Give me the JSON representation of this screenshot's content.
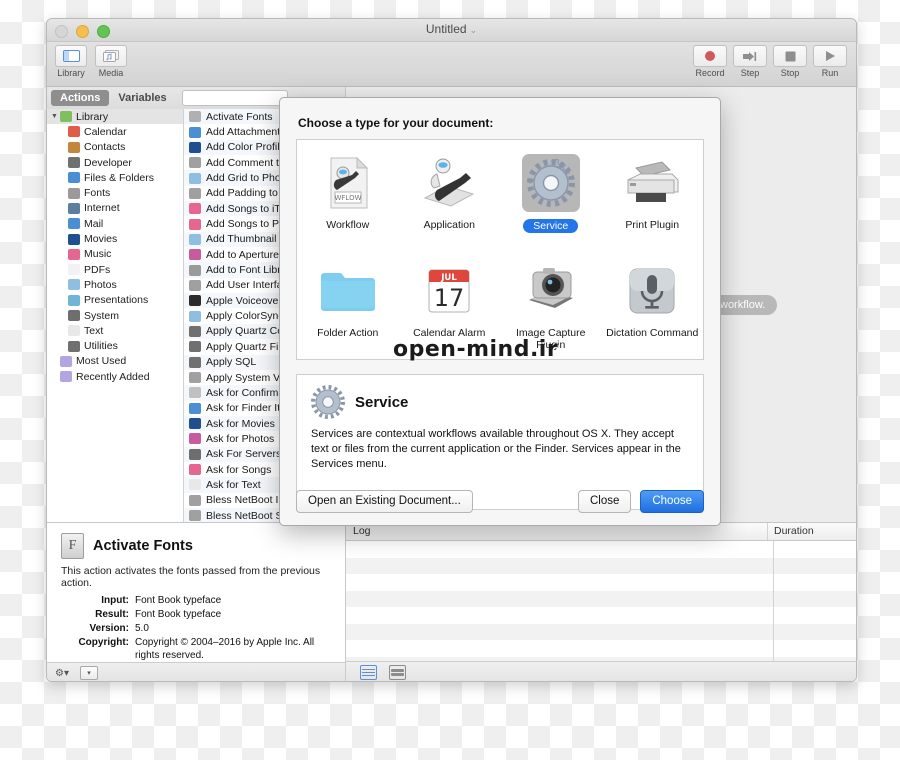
{
  "window": {
    "title": "Untitled",
    "title_chevron": "⌄"
  },
  "toolbar": {
    "left_buttons": [
      {
        "label": "Library",
        "icon": "sidebar-icon",
        "active": true
      },
      {
        "label": "Media",
        "icon": "media-icon",
        "active": false
      }
    ],
    "right_buttons": [
      {
        "label": "Record",
        "icon": "record-icon"
      },
      {
        "label": "Step",
        "icon": "step-icon"
      },
      {
        "label": "Stop",
        "icon": "stop-icon"
      },
      {
        "label": "Run",
        "icon": "run-icon"
      }
    ]
  },
  "tabs": {
    "items": [
      {
        "label": "Actions",
        "active": true
      },
      {
        "label": "Variables",
        "active": false
      }
    ],
    "search_value": "",
    "search_placeholder": ""
  },
  "sidebar": {
    "items": [
      {
        "label": "Library",
        "level": 0,
        "color": "#7fbf5f",
        "header": true
      },
      {
        "label": "Calendar",
        "level": 1,
        "color": "#e05c4a"
      },
      {
        "label": "Contacts",
        "level": 1,
        "color": "#c2873c"
      },
      {
        "label": "Developer",
        "level": 1,
        "color": "#707070"
      },
      {
        "label": "Files & Folders",
        "level": 1,
        "color": "#4a8fd4"
      },
      {
        "label": "Fonts",
        "level": 1,
        "color": "#9a9a9a"
      },
      {
        "label": "Internet",
        "level": 1,
        "color": "#5b7f9e"
      },
      {
        "label": "Mail",
        "level": 1,
        "color": "#4a8fd4"
      },
      {
        "label": "Movies",
        "level": 1,
        "color": "#1f4f8f"
      },
      {
        "label": "Music",
        "level": 1,
        "color": "#e7668f"
      },
      {
        "label": "PDFs",
        "level": 1,
        "color": "#f2f2f2"
      },
      {
        "label": "Photos",
        "level": 1,
        "color": "#8fbfe0"
      },
      {
        "label": "Presentations",
        "level": 1,
        "color": "#6fb5d8"
      },
      {
        "label": "System",
        "level": 1,
        "color": "#6e6e6e"
      },
      {
        "label": "Text",
        "level": 1,
        "color": "#e8e8e8"
      },
      {
        "label": "Utilities",
        "level": 1,
        "color": "#707070"
      },
      {
        "label": "Most Used",
        "level": 2,
        "color": "#b3a6e0"
      },
      {
        "label": "Recently Added",
        "level": 2,
        "color": "#b3a6e0"
      }
    ]
  },
  "actions": {
    "items": [
      {
        "label": "Activate Fonts",
        "color": "#b0b0b0",
        "selected": true
      },
      {
        "label": "Add Attachments to Front Message",
        "color": "#4a8fd4"
      },
      {
        "label": "Add Color Profile",
        "color": "#1f4f8f"
      },
      {
        "label": "Add Comment to DVD Track",
        "color": "#a0a0a0"
      },
      {
        "label": "Add Grid to Photos",
        "color": "#8fbfe0"
      },
      {
        "label": "Add Padding to Photos",
        "color": "#a0a0a0"
      },
      {
        "label": "Add Songs to iTunes",
        "color": "#e7668f"
      },
      {
        "label": "Add Songs to Playlist",
        "color": "#e7668f"
      },
      {
        "label": "Add Thumbnail Icon to Image Files",
        "color": "#8fbfe0"
      },
      {
        "label": "Add to Aperture Library",
        "color": "#c85a9e"
      },
      {
        "label": "Add to Font Library",
        "color": "#9a9a9a"
      },
      {
        "label": "Add User Interface Elements",
        "color": "#a0a0a0"
      },
      {
        "label": "Apple Voiceover Utility",
        "color": "#2b2b2b"
      },
      {
        "label": "Apply ColorSync Profile to Images",
        "color": "#8fbfe0"
      },
      {
        "label": "Apply Quartz Composition Filter",
        "color": "#707070"
      },
      {
        "label": "Apply Quartz Filter to PDF Documents",
        "color": "#707070"
      },
      {
        "label": "Apply SQL",
        "color": "#707070"
      },
      {
        "label": "Apply System Voice",
        "color": "#a0a0a0"
      },
      {
        "label": "Ask for Confirmation",
        "color": "#c0c0c0"
      },
      {
        "label": "Ask for Finder Items",
        "color": "#4a8fd4"
      },
      {
        "label": "Ask for Movies",
        "color": "#1f4f8f"
      },
      {
        "label": "Ask for Photos",
        "color": "#c85a9e"
      },
      {
        "label": "Ask For Servers",
        "color": "#6e6e6e"
      },
      {
        "label": "Ask for Songs",
        "color": "#e7668f"
      },
      {
        "label": "Ask for Text",
        "color": "#e8e8e8"
      },
      {
        "label": "Bless NetBoot Image",
        "color": "#a0a0a0"
      },
      {
        "label": "Bless NetBoot Server",
        "color": "#a0a0a0"
      }
    ]
  },
  "main": {
    "hint_pill": "workflow."
  },
  "info_panel": {
    "icon": "font-file-icon",
    "title": "Activate Fonts",
    "description": "This action activates the fonts passed from the previous action.",
    "rows": [
      {
        "key": "Input:",
        "value": "Font Book typeface"
      },
      {
        "key": "Result:",
        "value": "Font Book typeface"
      },
      {
        "key": "Version:",
        "value": "5.0"
      },
      {
        "key": "Copyright:",
        "value": "Copyright © 2004–2016 by Apple Inc. All rights reserved."
      }
    ],
    "bottom_icons": [
      "gear-icon",
      "chevron-down-icon"
    ]
  },
  "log_panel": {
    "columns": [
      "Log",
      "Duration"
    ],
    "rows": [],
    "row_count": 8,
    "bottom_icons": [
      "list-view-icon",
      "stack-view-icon"
    ]
  },
  "dialog": {
    "title": "Choose a type for your document:",
    "types": [
      {
        "label": "Workflow",
        "icon": "workflow-icon",
        "selected": false
      },
      {
        "label": "Application",
        "icon": "application-icon",
        "selected": false
      },
      {
        "label": "Service",
        "icon": "service-gear-icon",
        "selected": true
      },
      {
        "label": "Print Plugin",
        "icon": "printer-icon",
        "selected": false
      },
      {
        "label": "Folder Action",
        "icon": "folder-icon",
        "selected": false
      },
      {
        "label": "Calendar Alarm",
        "icon": "calendar-icon",
        "selected": false
      },
      {
        "label": "Image Capture Plugin",
        "icon": "camera-icon",
        "selected": false
      },
      {
        "label": "Dictation Command",
        "icon": "microphone-icon",
        "selected": false
      }
    ],
    "calendar_icon": {
      "month": "JUL",
      "day": "17"
    },
    "workflow_icon_badge": "WFLOW",
    "detail": {
      "icon": "service-gear-icon",
      "title": "Service",
      "body": "Services are contextual workflows available throughout OS X. They accept text or files from the current application or the Finder. Services appear in the Services menu."
    },
    "buttons": {
      "open_existing": "Open an Existing Document...",
      "close": "Close",
      "choose": "Choose"
    }
  },
  "watermark": {
    "text": "open-mind.ir"
  },
  "colors": {
    "accent_blue": "#2475e8",
    "selection_gray": "#b7b7b7",
    "record_red": "#d05a5a"
  }
}
